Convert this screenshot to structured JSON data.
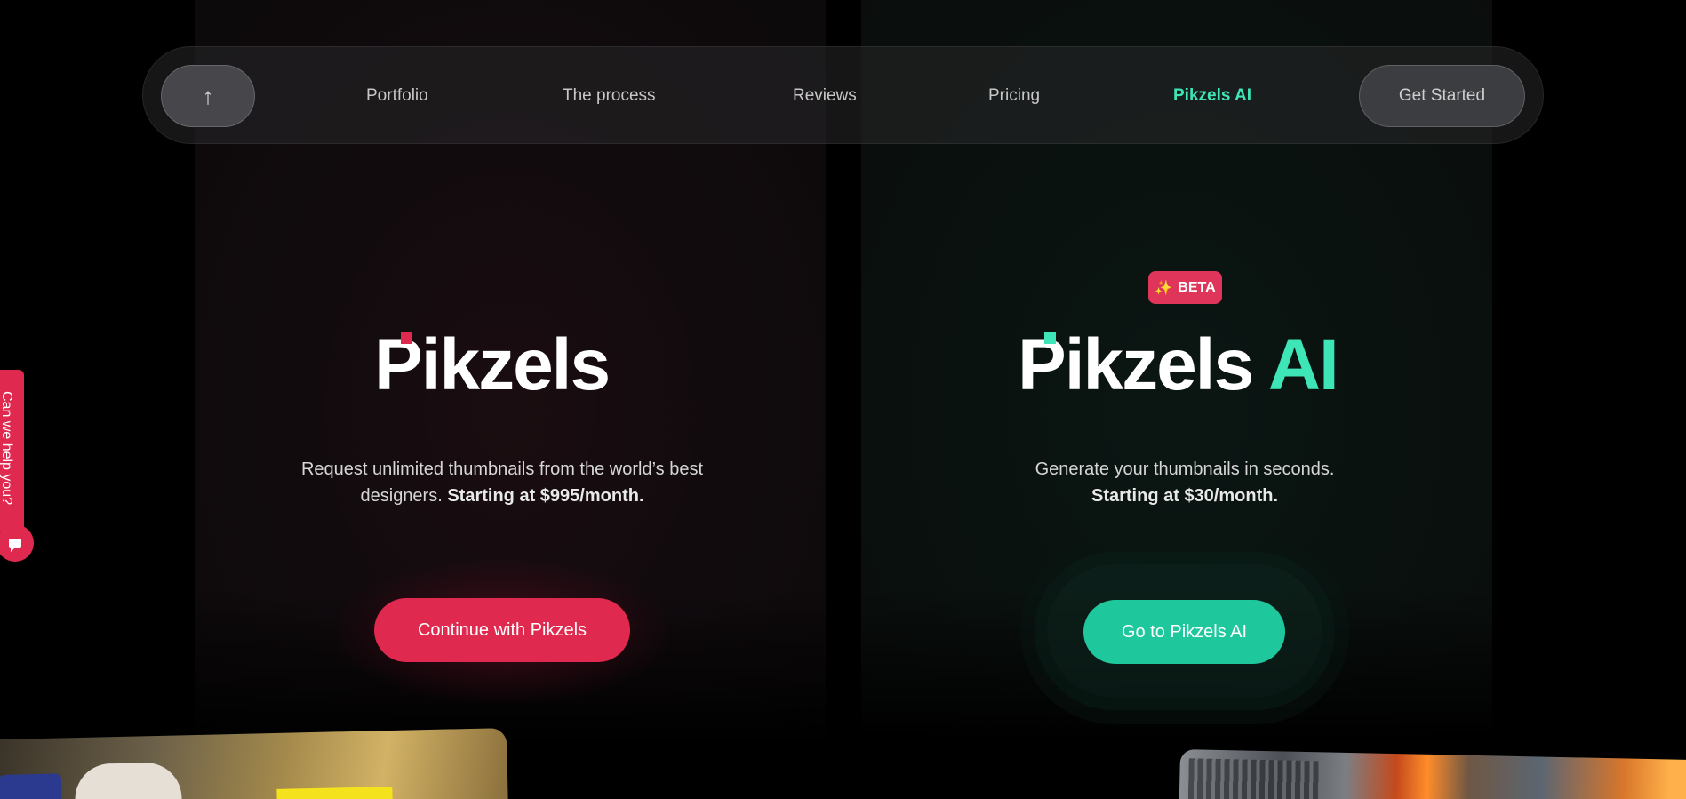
{
  "nav": {
    "back_to_top_icon": "arrow-up-icon",
    "back_to_top_glyph": "↑",
    "links": [
      "Portfolio",
      "The process",
      "Reviews",
      "Pricing",
      "Pikzels AI"
    ],
    "active_link": "Pikzels AI",
    "cta_label": "Get Started"
  },
  "left": {
    "logo_text": "Pikzels",
    "description": "Request unlimited thumbnails from the world’s best designers.",
    "price_text": "Starting at $995/month.",
    "button_label": "Continue with Pikzels"
  },
  "right": {
    "badge_icon": "sparkles-icon",
    "badge_glyph": "✨",
    "badge_label": "BETA",
    "logo_text": "Pikzels",
    "logo_suffix": "AI",
    "description": "Generate your thumbnails in seconds.",
    "price_text": "Starting at $30/month.",
    "button_label": "Go to Pikzels AI"
  },
  "help": {
    "label": "Can we help you?",
    "icon": "chat-icon"
  },
  "colors": {
    "brand_red": "#e0294f",
    "brand_teal": "#3ee6b7",
    "button_teal": "#1fc79d"
  }
}
